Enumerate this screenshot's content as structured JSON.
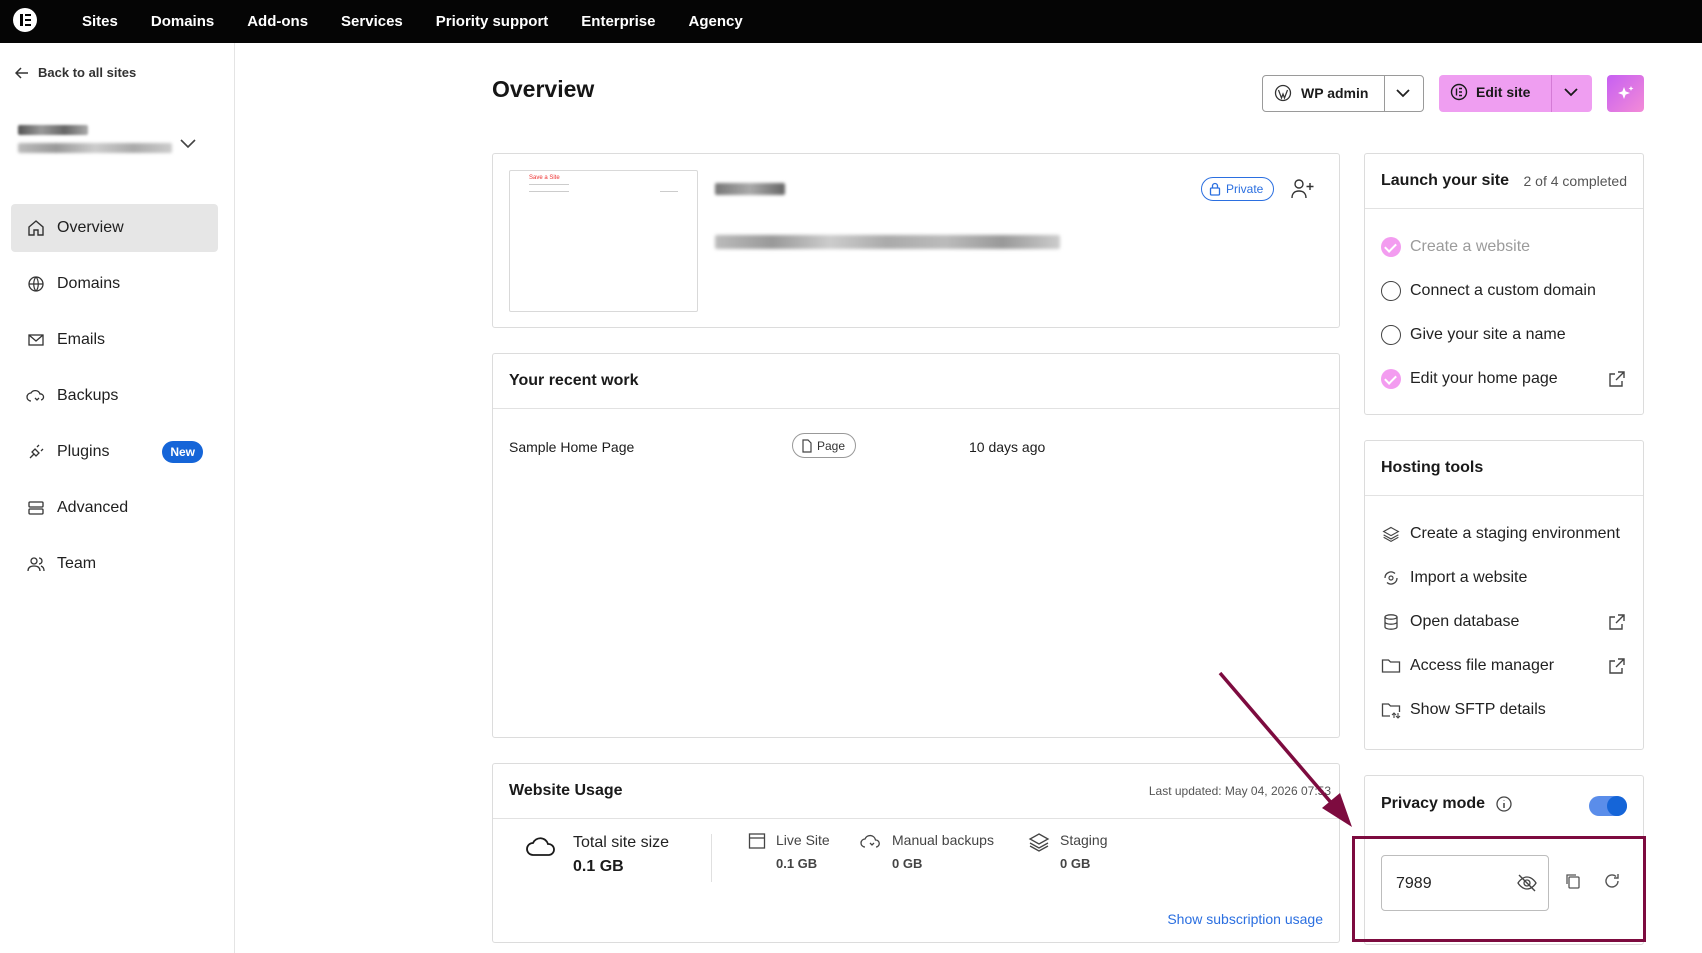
{
  "topnav": {
    "items": [
      "Sites",
      "Domains",
      "Add-ons",
      "Services",
      "Priority support",
      "Enterprise",
      "Agency"
    ]
  },
  "sidebar": {
    "back_label": "Back to all sites",
    "items": [
      {
        "label": "Overview",
        "icon": "home-icon"
      },
      {
        "label": "Domains",
        "icon": "globe-icon"
      },
      {
        "label": "Emails",
        "icon": "mail-icon"
      },
      {
        "label": "Backups",
        "icon": "cloud-sync-icon"
      },
      {
        "label": "Plugins",
        "icon": "plug-icon",
        "badge": "New"
      },
      {
        "label": "Advanced",
        "icon": "server-icon"
      },
      {
        "label": "Team",
        "icon": "team-icon"
      }
    ]
  },
  "header": {
    "title": "Overview",
    "wp_admin_label": "WP admin",
    "edit_site_label": "Edit site"
  },
  "site_card": {
    "private_label": "Private",
    "thumbnail_title": "Save a Site"
  },
  "recent_work": {
    "title": "Your recent work",
    "rows": [
      {
        "name": "Sample Home Page",
        "type": "Page",
        "time": "10 days ago"
      }
    ]
  },
  "usage": {
    "title": "Website Usage",
    "last_updated": "Last updated: May 04, 2026 07:53",
    "total_label": "Total site size",
    "total_value": "0.1 GB",
    "items": [
      {
        "label": "Live Site",
        "value": "0.1 GB"
      },
      {
        "label": "Manual backups",
        "value": "0 GB"
      },
      {
        "label": "Staging",
        "value": "0 GB"
      }
    ],
    "link": "Show subscription usage"
  },
  "launch": {
    "title": "Launch your site",
    "progress": "2 of 4 completed",
    "steps": [
      {
        "label": "Create a website",
        "done": true
      },
      {
        "label": "Connect a custom domain",
        "done": false
      },
      {
        "label": "Give your site a name",
        "done": false
      },
      {
        "label": "Edit your home page",
        "done": true
      }
    ]
  },
  "hosting": {
    "title": "Hosting tools",
    "items": [
      {
        "label": "Create a staging environment",
        "icon": "layers-icon"
      },
      {
        "label": "Import a website",
        "icon": "import-icon"
      },
      {
        "label": "Open database",
        "icon": "database-icon"
      },
      {
        "label": "Access file manager",
        "icon": "folder-icon"
      },
      {
        "label": "Show SFTP details",
        "icon": "sftp-folder-icon"
      }
    ]
  },
  "privacy": {
    "title": "Privacy mode",
    "enabled": true,
    "password": "7989"
  },
  "colors": {
    "accent": "#ef9ef1",
    "link": "#2b6fe0",
    "annotation": "#7d0b3f"
  }
}
